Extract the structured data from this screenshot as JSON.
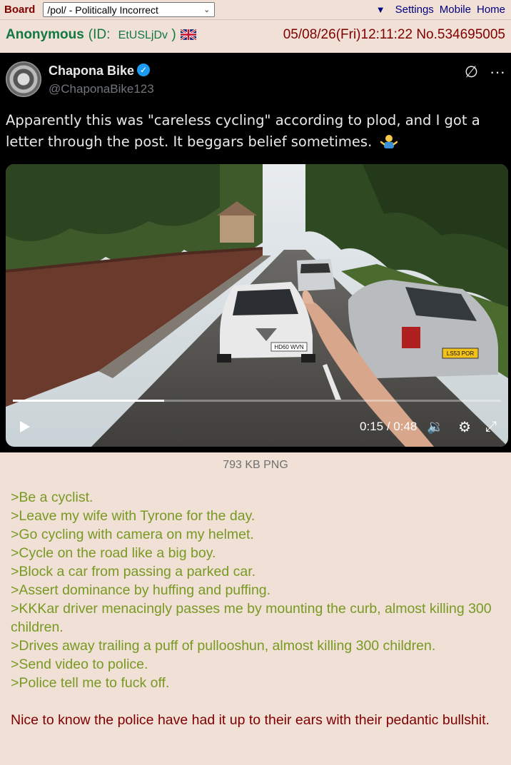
{
  "topbar": {
    "board_label": "Board",
    "board_selected": "/pol/ - Politically Incorrect",
    "settings": "Settings",
    "mobile": "Mobile",
    "home": "Home"
  },
  "post": {
    "name": "Anonymous",
    "id_prefix": "(ID:",
    "poster_id": "EtUSLjDv",
    "id_suffix": ")",
    "flag_icon": "uk-flag-icon",
    "datetime": "05/08/26(Fri)12:11:22 No.534695005",
    "file_info": "793 KB PNG"
  },
  "tweet": {
    "display_name": "Chapona Bike",
    "handle": "@ChaponaBike123",
    "text": "Apparently this was \"careless cycling\" according to plod, and I got a letter through the post. It beggars belief sometimes.",
    "video": {
      "time": "0:15 / 0:48",
      "progress": 0.31,
      "plate_left": "HD60 WVN",
      "plate_right": "LS53 POR"
    }
  },
  "comment": {
    "greentext": [
      ">Be a cyclist.",
      ">Leave my wife with Tyrone for the day.",
      ">Go cycling with camera on my helmet.",
      ">Cycle on the road like a big boy.",
      ">Block a car from passing a parked car.",
      ">Assert dominance by huffing and puffing.",
      ">KKKar driver menacingly passes me by mounting the curb, almost killing 300 children.",
      ">Drives away trailing a puff of pullooshun, almost killing 300 children.",
      ">Send video to police.",
      ">Police tell me to fuck off."
    ],
    "closing": "Nice to know the police have had it up to their ears with their pedantic bullshit."
  }
}
